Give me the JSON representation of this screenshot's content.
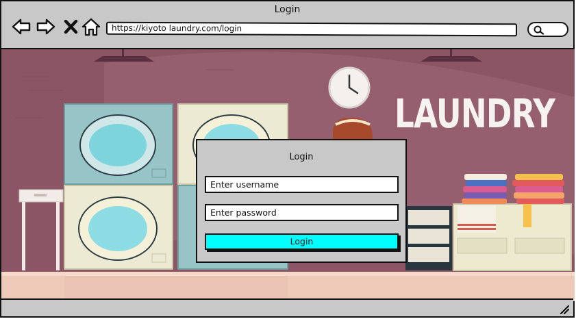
{
  "window": {
    "title": "Login"
  },
  "toolbar": {
    "url": "https://kiyoto laundry.com/login",
    "icons": [
      "back-arrow-icon",
      "forward-arrow-icon",
      "close-icon",
      "home-icon",
      "search-icon"
    ]
  },
  "scene": {
    "brand_text": "LAUNDRY"
  },
  "login": {
    "title": "Login",
    "username_placeholder": "Enter username",
    "password_placeholder": "Enter password",
    "button_label": "Login"
  },
  "colors": {
    "accent_button": "#00ffff",
    "chrome": "#c8c8c8",
    "wall": "#8a5563"
  }
}
